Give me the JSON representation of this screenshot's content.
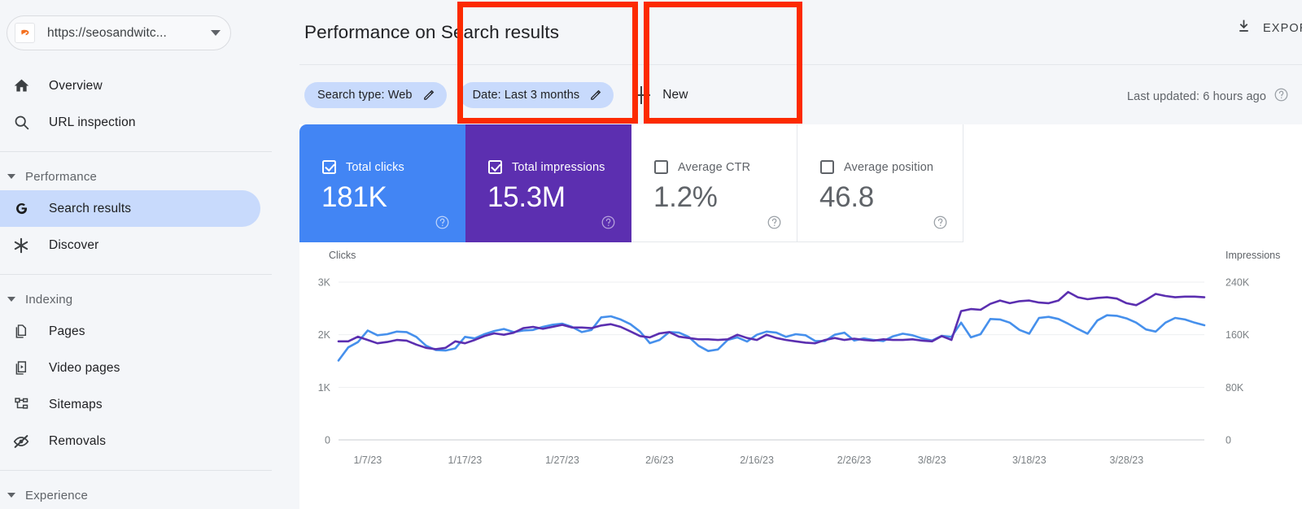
{
  "sidebar": {
    "property": {
      "url": "https://seosandwitc...",
      "favicon_name": "site-favicon",
      "dropdown_icon": "chevron-down-icon"
    },
    "items": [
      {
        "label": "Overview",
        "icon": "home-icon",
        "id": "overview",
        "active": false
      },
      {
        "label": "URL inspection",
        "icon": "search-icon",
        "id": "url-inspection",
        "active": false
      }
    ],
    "groups": [
      {
        "label": "Performance",
        "icon": "chevron-down-icon",
        "items": [
          {
            "label": "Search results",
            "icon": "google-g-icon",
            "id": "search-results",
            "active": true
          },
          {
            "label": "Discover",
            "icon": "asterisk-icon",
            "id": "discover",
            "active": false
          }
        ]
      },
      {
        "label": "Indexing",
        "icon": "chevron-down-icon",
        "items": [
          {
            "label": "Pages",
            "icon": "pages-icon",
            "id": "pages",
            "active": false
          },
          {
            "label": "Video pages",
            "icon": "video-pages-icon",
            "id": "video-pages",
            "active": false
          },
          {
            "label": "Sitemaps",
            "icon": "sitemaps-icon",
            "id": "sitemaps",
            "active": false
          },
          {
            "label": "Removals",
            "icon": "eye-off-icon",
            "id": "removals",
            "active": false
          }
        ]
      },
      {
        "label": "Experience",
        "icon": "chevron-down-icon",
        "items": []
      }
    ]
  },
  "header": {
    "title": "Performance on Search results",
    "export_label": "EXPORT",
    "export_icon": "download-icon"
  },
  "filters": {
    "chips": [
      {
        "label": "Search type: Web",
        "edit_icon": "pencil-icon"
      },
      {
        "label": "Date: Last 3 months",
        "edit_icon": "pencil-icon"
      }
    ],
    "new_label": "New",
    "new_icon": "plus-icon",
    "last_updated": "Last updated: 6 hours ago",
    "last_updated_icon": "help-circle-icon"
  },
  "metrics": [
    {
      "label": "Total clicks",
      "value": "181K",
      "checked": true,
      "state": "selected-blue",
      "help_icon": "help-circle-icon"
    },
    {
      "label": "Total impressions",
      "value": "15.3M",
      "checked": true,
      "state": "selected-purple",
      "help_icon": "help-circle-icon"
    },
    {
      "label": "Average CTR",
      "value": "1.2%",
      "checked": false,
      "state": "unselected",
      "help_icon": "help-circle-icon"
    },
    {
      "label": "Average position",
      "value": "46.8",
      "checked": false,
      "state": "unselected",
      "help_icon": "help-circle-icon"
    }
  ],
  "annotations": [
    {
      "name": "highlight-total-impressions",
      "color": "#fc2a00"
    },
    {
      "name": "highlight-average-ctr",
      "color": "#fc2a00"
    }
  ],
  "colors": {
    "clicks_line": "#4690ec",
    "impressions_line": "#5b2fb0",
    "card_blue": "#4285f4",
    "card_purple": "#5c2fb0",
    "annotation_red": "#fc2a00",
    "sidebar_bg": "#f4f6f9",
    "active_nav": "#c8dafc"
  },
  "chart_data": {
    "type": "line",
    "title": "",
    "xlabel": "",
    "left_axis_label": "Clicks",
    "right_axis_label": "Impressions",
    "left_ticks": [
      "3K",
      "2K",
      "1K",
      "0"
    ],
    "right_ticks": [
      "240K",
      "160K",
      "80K",
      "0"
    ],
    "left_ylim": [
      0,
      3000
    ],
    "right_ylim": [
      0,
      240000
    ],
    "grid": true,
    "legend": "none",
    "x_tick_labels": [
      "1/7/23",
      "1/17/23",
      "1/27/23",
      "2/6/23",
      "2/16/23",
      "2/26/23",
      "3/8/23",
      "3/18/23",
      "3/28/23"
    ],
    "x_tick_positions": [
      3,
      13,
      23,
      33,
      43,
      53,
      61,
      71,
      81
    ],
    "n_points": 90,
    "series": [
      {
        "name": "Clicks",
        "color": "#4690ec",
        "axis": "left",
        "values": [
          1510,
          1760,
          1860,
          2080,
          1990,
          2010,
          2060,
          2050,
          1960,
          1790,
          1710,
          1700,
          1740,
          1960,
          1930,
          2010,
          2070,
          2110,
          2050,
          2080,
          2090,
          2150,
          2190,
          2210,
          2150,
          2050,
          2090,
          2330,
          2350,
          2290,
          2200,
          2060,
          1840,
          1900,
          2050,
          2040,
          1960,
          1790,
          1690,
          1720,
          1900,
          1950,
          1870,
          2000,
          2060,
          2040,
          1960,
          2010,
          1990,
          1880,
          1880,
          2000,
          2040,
          1890,
          1930,
          1900,
          1880,
          1970,
          2020,
          1990,
          1930,
          1890,
          1980,
          1960,
          2230,
          1950,
          2010,
          2300,
          2290,
          2230,
          2090,
          2020,
          2320,
          2340,
          2300,
          2210,
          2110,
          2020,
          2270,
          2370,
          2360,
          2310,
          2230,
          2100,
          2060,
          2230,
          2320,
          2290,
          2230,
          2180
        ]
      },
      {
        "name": "Impressions",
        "color": "#5b2fb0",
        "axis": "right",
        "values": [
          150000,
          150000,
          157000,
          152000,
          147000,
          149000,
          152000,
          151000,
          145000,
          140000,
          138000,
          140000,
          150000,
          147000,
          152000,
          158000,
          162000,
          160000,
          163000,
          170000,
          172000,
          169000,
          172000,
          175000,
          171000,
          171000,
          170000,
          174000,
          176000,
          172000,
          165000,
          158000,
          156000,
          162000,
          164000,
          157000,
          155000,
          153000,
          153000,
          152000,
          153000,
          160000,
          155000,
          152000,
          160000,
          155000,
          152000,
          150000,
          148000,
          147000,
          152000,
          155000,
          152000,
          154000,
          152000,
          151000,
          153000,
          152000,
          152000,
          153000,
          151000,
          150000,
          158000,
          152000,
          196000,
          199000,
          198000,
          207000,
          212000,
          208000,
          211000,
          212000,
          209000,
          208000,
          212000,
          225000,
          217000,
          214000,
          216000,
          217000,
          215000,
          208000,
          205000,
          213000,
          222000,
          219000,
          217000,
          218000,
          218000,
          217000
        ]
      }
    ]
  }
}
